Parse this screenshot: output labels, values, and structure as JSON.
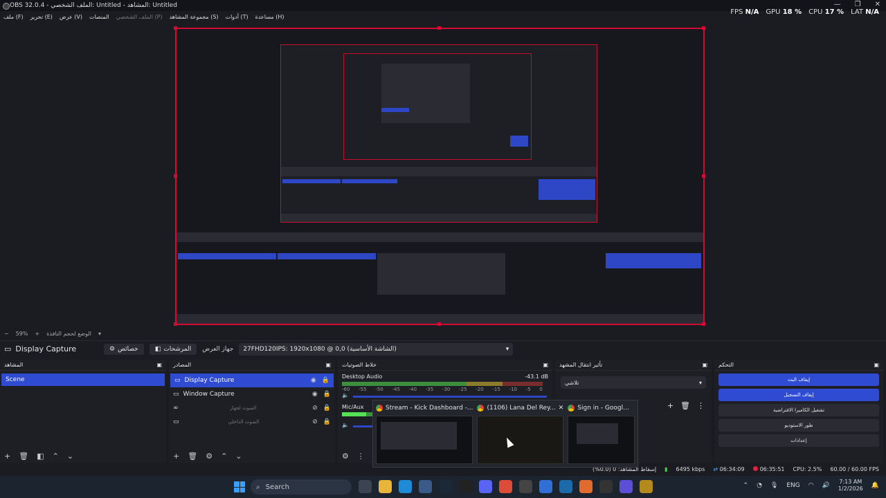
{
  "window": {
    "title": "OBS 32.0.4 - الملف الشخصي: Untitled - المشاهد: Untitled",
    "controls": [
      "—",
      "❐",
      "✕"
    ]
  },
  "menu": {
    "items": [
      "ملف (F)",
      "تحرير (E)",
      "عرض (V)",
      "المنصات",
      "الملف الشخصي (P)",
      "مجموعة المشاهد (S)",
      "أدوات (T)",
      "مساعدة (H)"
    ]
  },
  "stats": {
    "fps_label": "FPS",
    "fps_value": "N/A",
    "gpu_label": "GPU",
    "gpu_value": "18 %",
    "cpu_label": "CPU",
    "cpu_value": "17 %",
    "lat_label": "LAT",
    "lat_value": "N/A"
  },
  "zoom": {
    "percent": "59%",
    "label": "الوضع لحجم النافذة"
  },
  "sourcebar": {
    "title": "Display Capture",
    "properties_label": "خصائص",
    "filters_label": "المرشحات",
    "device_label": "جهاز العرض",
    "device_value": "27FHD120IPS: 1920x1080 @ 0,0 (الشاشة الأساسية)"
  },
  "scenes": {
    "title": "المشاهد",
    "items": [
      "Scene"
    ]
  },
  "sources": {
    "title": "المصادر",
    "items": [
      {
        "name": "Display Capture"
      },
      {
        "name": "Window Capture"
      },
      {
        "name": "الصوت لجهاز"
      },
      {
        "name": "الصوت الداخلي"
      }
    ]
  },
  "mixer": {
    "title": "خلاط الصوتيات",
    "desktop_audio": "Desktop Audio",
    "desktop_db": "-43.1 dB",
    "mic": "Mic/Aux",
    "ticks": [
      "-60",
      "-55",
      "-50",
      "-45",
      "-40",
      "-35",
      "-30",
      "-25",
      "-20",
      "-15",
      "-10",
      "-5",
      "0"
    ]
  },
  "transitions": {
    "title": "تأثير انتقال المشهد",
    "selected": "تلاشي"
  },
  "controls": {
    "title": "التحكم",
    "buttons": [
      "إيقاف البث",
      "إيقاف التسجيل",
      "تشغيل الكاميرا الافتراضية",
      "طور الاستوديو",
      "إعدادات"
    ]
  },
  "statusbar": {
    "network": "إسقاط المشاهد: 0 (0.0%)",
    "kbps": "6495 kbps",
    "stream_time": "06:34:09",
    "rec_time": "06:35:51",
    "cpu": "CPU: 2.5%",
    "fps": "60.00 / 60.00 FPS"
  },
  "popup": {
    "thumbs": [
      {
        "title": "Stream - Kick Dashboard -..."
      },
      {
        "title": "(1106) Lana Del Rey..."
      },
      {
        "title": "Sign in - Googl..."
      }
    ],
    "close_label": "✕"
  },
  "taskbar": {
    "search_placeholder": "Search",
    "lang": "ENG",
    "time": "7:13 AM",
    "date": "1/2/2026"
  },
  "colors": {
    "accent": "#2f4bd2",
    "record": "#d60a35"
  }
}
